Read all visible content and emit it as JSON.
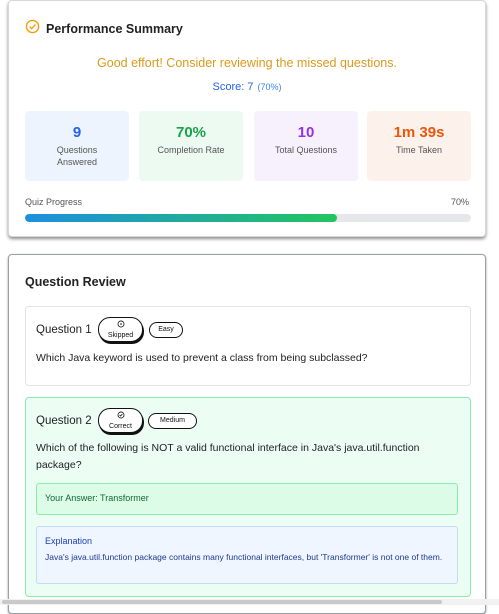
{
  "summary": {
    "title": "Performance Summary",
    "message": "Good effort! Consider reviewing the missed questions.",
    "score_label": "Score: 7",
    "score_pct": "(70%)",
    "stats": [
      {
        "value": "9",
        "label": "Questions Answered",
        "color": "#2563eb",
        "bg": "#eef4fd"
      },
      {
        "value": "70%",
        "label": "Completion Rate",
        "color": "#16a34a",
        "bg": "#edfaf2"
      },
      {
        "value": "10",
        "label": "Total Questions",
        "color": "#9333ea",
        "bg": "#f7f1fd"
      },
      {
        "value": "1m 39s",
        "label": "Time Taken",
        "color": "#ea580c",
        "bg": "#fdf2eb"
      }
    ],
    "progress_label": "Quiz Progress",
    "progress_text": "70%",
    "progress_fraction": 0.7
  },
  "review": {
    "title": "Question Review",
    "questions": [
      {
        "label": "Question 1",
        "status": "Skipped",
        "difficulty": "Easy",
        "text": "Which Java keyword is used to prevent a class from being subclassed?"
      },
      {
        "label": "Question 2",
        "status": "Correct",
        "difficulty": "Medium",
        "text": "Which of the following is NOT a valid functional interface in Java's java.util.function package?",
        "answer": "Your Answer: Transformer",
        "explanation_title": "Explanation",
        "explanation": "Java's java.util.function package contains many functional interfaces, but 'Transformer' is not one of them."
      }
    ]
  }
}
